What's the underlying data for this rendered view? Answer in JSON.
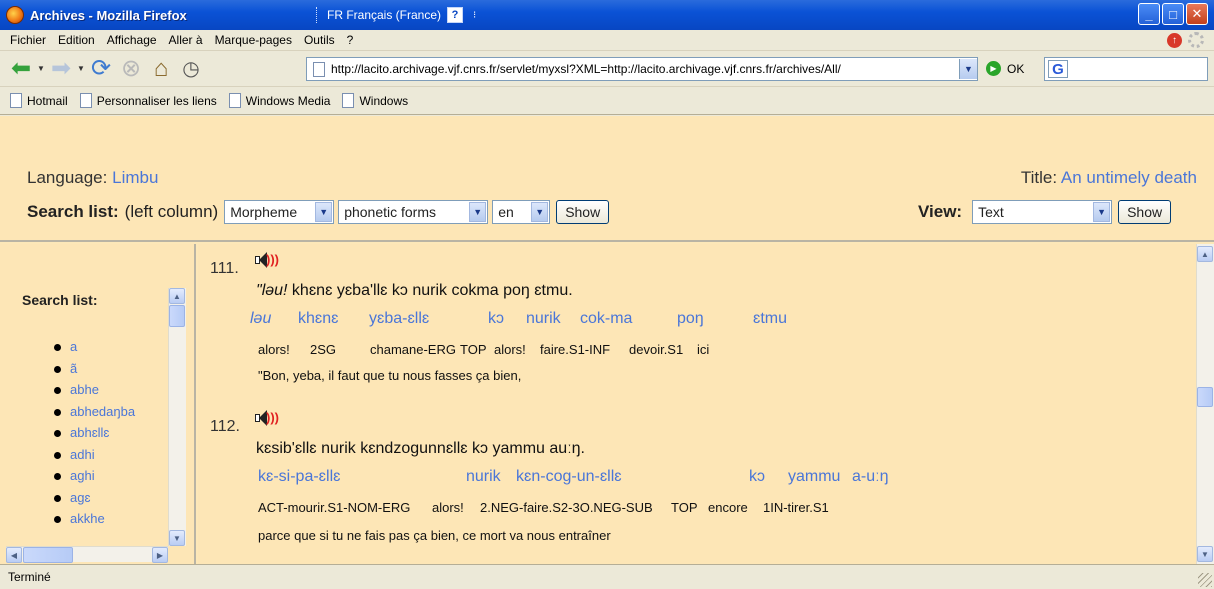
{
  "window": {
    "title": "Archives - Mozilla Firefox",
    "language_indicator": "FR Français (France)",
    "help_glyph": "?",
    "buttons": [
      "_",
      "□",
      "✕"
    ]
  },
  "menu": [
    "Fichier",
    "Edition",
    "Affichage",
    "Aller à",
    "Marque-pages",
    "Outils",
    "?"
  ],
  "navbar": {
    "url": "http://lacito.archivage.vjf.cnrs.fr/servlet/myxsl?XML=http://lacito.archivage.vjf.cnrs.fr/archives/All/",
    "go_label": "OK",
    "search_logo": "G"
  },
  "bookmarks": [
    "Hotmail",
    "Personnaliser les liens",
    "Windows Media",
    "Windows"
  ],
  "page": {
    "language_label": "Language:",
    "language_value": "Limbu",
    "title_label": "Title:",
    "title_value": "An untimely death",
    "search_label": "Search list:",
    "search_hint": "(left column)",
    "select_type": "Morpheme",
    "select_forms": "phonetic forms",
    "select_lang": "en",
    "show_label": "Show",
    "view_label": "View:",
    "view_value": "Text",
    "view_show_label": "Show"
  },
  "search_list": {
    "heading": "Search list:",
    "items": [
      "a",
      "ã",
      "abhe",
      "abhedaŋba",
      "abhɛllɛ",
      "adhi",
      "aghi",
      "agɛ",
      "akkhe"
    ]
  },
  "segments": [
    {
      "number": "111.",
      "original": "\"ləu! khɛnɛ yɛba'llɛ kɔ nurik cokma poŋ ɛtmu.",
      "original_italic": "ləu!",
      "original_rest": " khɛnɛ yɛba'llɛ kɔ nurik cokma poŋ ɛtmu.",
      "morphemes": [
        "ləu",
        "khɛnɛ",
        "yɛba-ɛllɛ",
        "kɔ",
        "nurik",
        "cok-ma",
        "poŋ",
        "ɛtmu"
      ],
      "glosses": [
        "alors!",
        "2SG",
        "chamane-ERG",
        "TOP",
        "alors!",
        "faire.S1-INF",
        "devoir.S1",
        "ici"
      ],
      "translation": "\"Bon, yeba, il faut que tu nous fasses ça bien,"
    },
    {
      "number": "112.",
      "original": "kɛsib'ɛllɛ nurik kɛndzogunnɛllɛ kɔ yammu auːŋ.",
      "morphemes": [
        "kɛ-si-pa-ɛllɛ",
        "nurik",
        "kɛn-cog-un-ɛllɛ",
        "kɔ",
        "yammu",
        "a-uːŋ"
      ],
      "glosses": [
        "ACT-mourir.S1-NOM-ERG",
        "alors!",
        "2.NEG-faire.S2-3O.NEG-SUB",
        "TOP",
        "encore",
        "1IN-tirer.S1"
      ],
      "translation": "parce que si tu ne fais pas ça bien, ce mort va nous entraîner"
    }
  ],
  "status": "Terminé"
}
